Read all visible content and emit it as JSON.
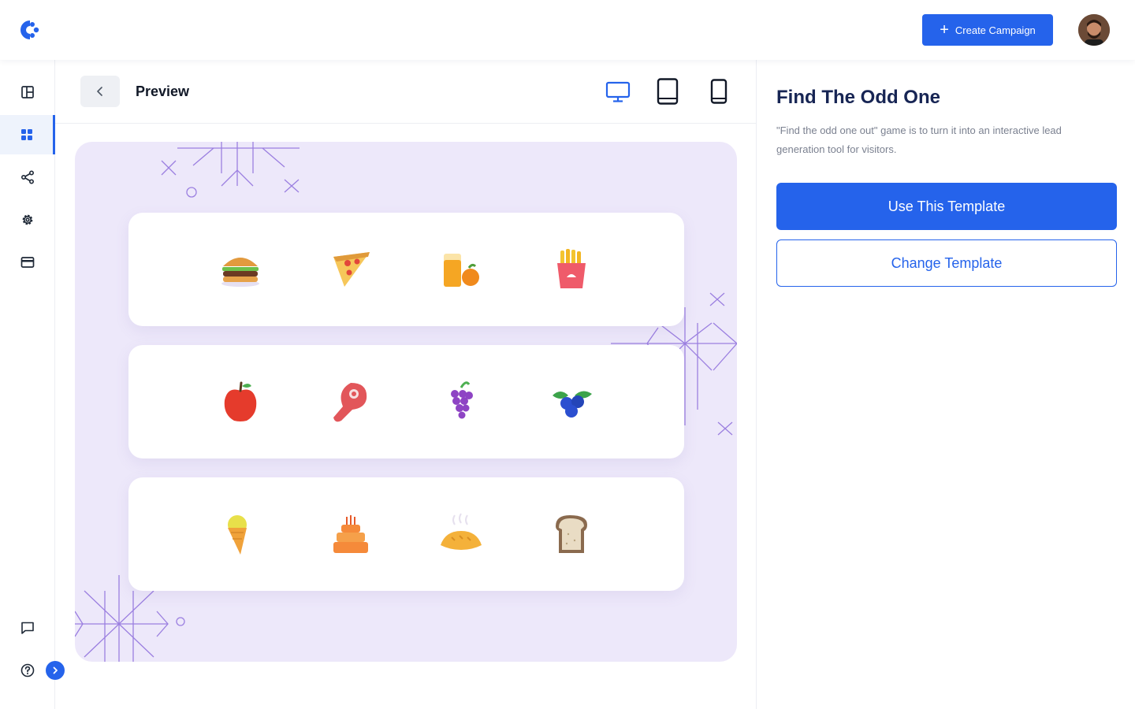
{
  "header": {
    "logo_icon": "brand-logo",
    "create_label": "Create Campaign",
    "create_icon": "plus-icon",
    "avatar_icon": "user-avatar"
  },
  "sidebar": {
    "items": [
      {
        "name": "layout-icon",
        "active": false
      },
      {
        "name": "grid-icon",
        "active": true
      },
      {
        "name": "share-icon",
        "active": false
      },
      {
        "name": "settings-icon",
        "active": false
      },
      {
        "name": "credit-card-icon",
        "active": false
      }
    ],
    "bottom_items": [
      {
        "name": "chat-icon"
      },
      {
        "name": "help-icon"
      }
    ],
    "expand_icon": "chevron-right-icon"
  },
  "preview": {
    "title": "Preview",
    "back_icon": "chevron-left-icon",
    "devices": [
      {
        "name": "desktop-icon",
        "active": true
      },
      {
        "name": "tablet-icon",
        "active": false
      },
      {
        "name": "mobile-icon",
        "active": false
      }
    ],
    "rows": [
      [
        "burger",
        "pizza",
        "orange-juice",
        "fries"
      ],
      [
        "apple",
        "steak",
        "grapes",
        "blueberries"
      ],
      [
        "ice-cream",
        "cake",
        "bread-loaf",
        "toast"
      ]
    ]
  },
  "panel": {
    "title": "Find The Odd One",
    "description": "\"Find the odd one out\" game is to turn it into an interactive lead generation tool for visitors.",
    "use_label": "Use This Template",
    "change_label": "Change Template"
  },
  "colors": {
    "accent": "#2563eb",
    "canvas_bg": "#ede8fa",
    "title": "#172554"
  }
}
